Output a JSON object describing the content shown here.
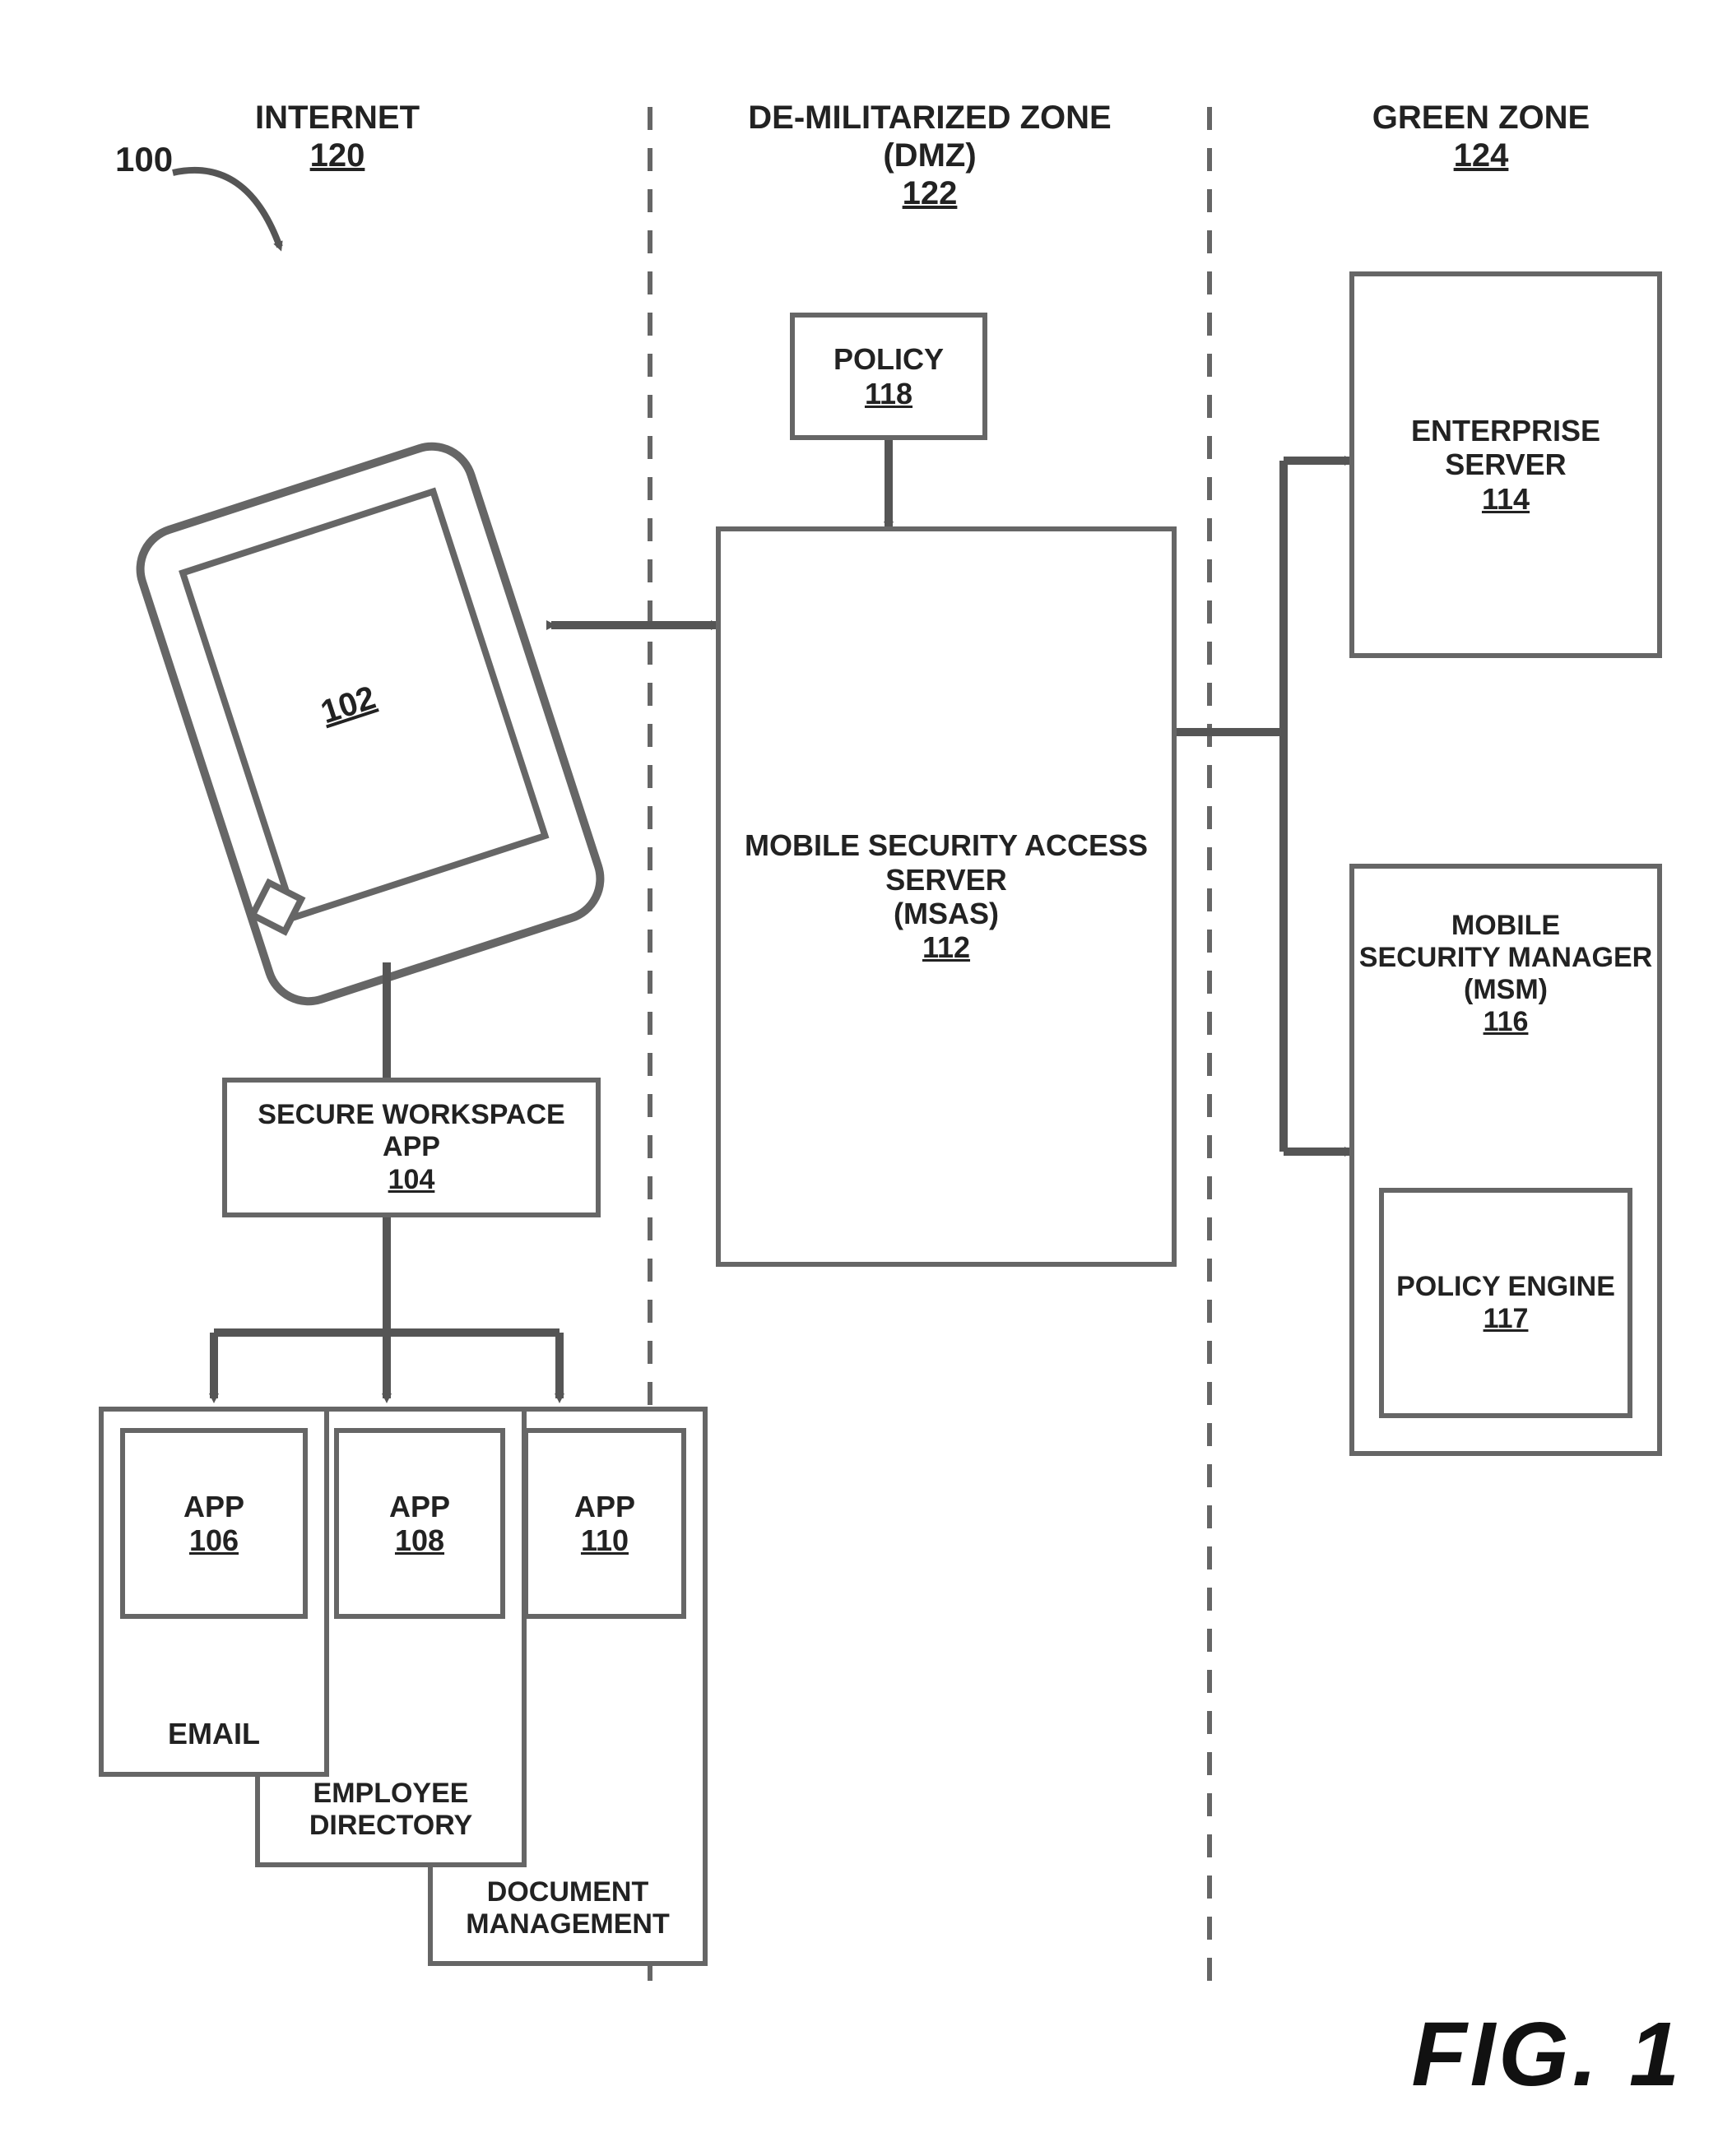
{
  "figure": {
    "number_label": "100",
    "caption": "FIG. 1"
  },
  "zones": {
    "internet": {
      "title": "INTERNET",
      "num": "120"
    },
    "dmz": {
      "title": "DE-MILITARIZED ZONE (DMZ)",
      "num": "122"
    },
    "green": {
      "title": "GREEN ZONE",
      "num": "124"
    }
  },
  "device": {
    "num": "102"
  },
  "secure_workspace": {
    "title": "SECURE WORKSPACE APP",
    "num": "104"
  },
  "app1": {
    "title": "APP",
    "num": "106",
    "subtitle": "EMAIL"
  },
  "app2": {
    "title": "APP",
    "num": "108",
    "subtitle_line1": "EMPLOYEE",
    "subtitle_line2": "DIRECTORY"
  },
  "app3": {
    "title": "APP",
    "num": "110",
    "subtitle_line1": "DOCUMENT",
    "subtitle_line2": "MANAGEMENT"
  },
  "policy_dmz": {
    "title": "POLICY",
    "num": "118"
  },
  "msas": {
    "title_line1": "MOBILE SECURITY ACCESS",
    "title_line2": "SERVER",
    "title_line3": "(MSAS)",
    "num": "112"
  },
  "enterprise_server": {
    "title_line1": "ENTERPRISE",
    "title_line2": "SERVER",
    "num": "114"
  },
  "msm": {
    "title_line1": "MOBILE",
    "title_line2": "SECURITY MANAGER",
    "title_line3": "(MSM)",
    "num": "116"
  },
  "policy_engine": {
    "title": "POLICY ENGINE",
    "num": "117"
  }
}
